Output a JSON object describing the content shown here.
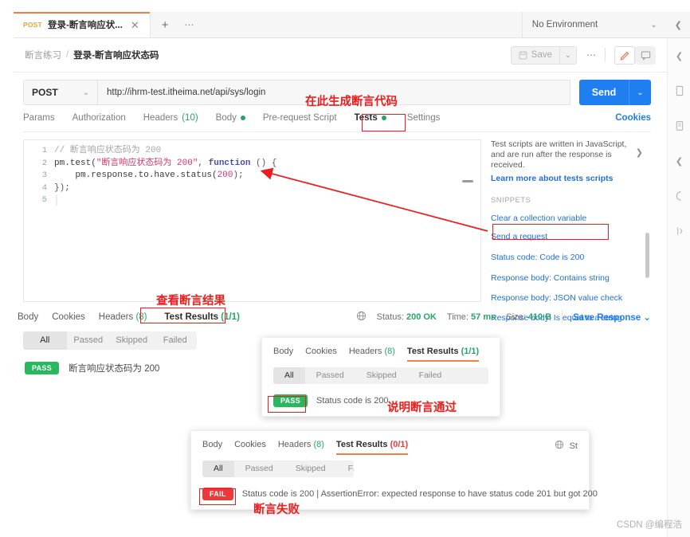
{
  "app": {
    "tab": {
      "method": "POST",
      "title": "登录-断言响应状...",
      "close": "✕",
      "plus": "+",
      "dots": "⋯"
    },
    "environment": {
      "label": "No Environment",
      "chevron": "⌄",
      "eye": "❮"
    },
    "breadcrumb": {
      "collection": "断言练习",
      "separator": "/",
      "request": "登录-断言响应状态码"
    },
    "actions": {
      "save": "Save",
      "save_caret": "⌄",
      "dots": "⋯"
    }
  },
  "request": {
    "method": "POST",
    "method_chevron": "⌄",
    "url": "http://ihrm-test.itheima.net/api/sys/login",
    "send_label": "Send",
    "send_caret": "⌄",
    "tabs": [
      {
        "label": "Params",
        "count": "",
        "dot": false,
        "active": false
      },
      {
        "label": "Authorization",
        "count": "",
        "dot": false,
        "active": false
      },
      {
        "label": "Headers",
        "count": "(10)",
        "dot": false,
        "active": false
      },
      {
        "label": "Body",
        "count": "",
        "dot": true,
        "active": false
      },
      {
        "label": "Pre-request Script",
        "count": "",
        "dot": false,
        "active": false
      },
      {
        "label": "Tests",
        "count": "",
        "dot": true,
        "active": true
      },
      {
        "label": "Settings",
        "count": "",
        "dot": false,
        "active": false
      }
    ],
    "cookies_link": "Cookies"
  },
  "editor": {
    "line_numbers": [
      "1",
      "2",
      "3",
      "4",
      "5"
    ],
    "lines": [
      {
        "n": "1",
        "comment": "// 断言响应状态码为 200"
      },
      {
        "n": "2",
        "text": "pm.test(\"断言响应状态码为 200\", function () {"
      },
      {
        "n": "3",
        "text": "    pm.response.to.have.status(200);"
      },
      {
        "n": "4",
        "text": "});"
      },
      {
        "n": "5",
        "text": ""
      }
    ],
    "l1_comment": "// 断言响应状态码为 200",
    "l2_a": "pm.test(",
    "l2_str": "\"断言响应状态码为 200\"",
    "l2_b": ", ",
    "l2_kw": "function",
    "l2_c": " () {",
    "l3_a": "    pm.response.to.have.status(",
    "l3_num": "200",
    "l3_b": ");",
    "l4": "});"
  },
  "snippets": {
    "help_text": "Test scripts are written in JavaScript, and are run after the response is received.",
    "learn_link": "Learn more about tests scripts",
    "expand_arrow": "❯",
    "section_label": "SNIPPETS",
    "items": [
      "Clear a collection variable",
      "Send a request",
      "Status code: Code is 200",
      "Response body: Contains string",
      "Response body: JSON value check",
      "Response body: Is equal to a string"
    ]
  },
  "response": {
    "tabs": [
      {
        "label": "Body",
        "count": "",
        "active": false
      },
      {
        "label": "Cookies",
        "count": "",
        "active": false
      },
      {
        "label": "Headers",
        "count": "(8)",
        "active": false
      },
      {
        "label": "Test Results",
        "count": "(1/1)",
        "active": true
      }
    ],
    "globe_icon": "⊕",
    "status_label": "Status:",
    "status_value": "200 OK",
    "time_label": "Time:",
    "time_value": "57 ms",
    "size_label": "Size:",
    "size_value": "410 B",
    "save_response": "Save Response",
    "save_response_caret": "⌄",
    "filters": [
      "All",
      "Passed",
      "Skipped",
      "Failed"
    ],
    "active_filter": "All",
    "result": {
      "badge": "PASS",
      "text": "断言响应状态码为 200"
    }
  },
  "overlay_pass": {
    "tabs": [
      {
        "label": "Body",
        "count": "",
        "active": false
      },
      {
        "label": "Cookies",
        "count": "",
        "active": false
      },
      {
        "label": "Headers",
        "count": "(8)",
        "active": false
      },
      {
        "label": "Test Results",
        "count": "(1/1)",
        "active": true
      }
    ],
    "filters": [
      "All",
      "Passed",
      "Skipped",
      "Failed"
    ],
    "active_filter": "All",
    "badge": "PASS",
    "text": "Status code is 200",
    "annotation": "说明断言通过"
  },
  "overlay_fail": {
    "tabs": [
      {
        "label": "Body",
        "count": "",
        "active": false
      },
      {
        "label": "Cookies",
        "count": "",
        "active": false
      },
      {
        "label": "Headers",
        "count": "(8)",
        "active": false
      },
      {
        "label": "Test Results",
        "count": "(0/1)",
        "active": true
      }
    ],
    "globe_icon": "⊕",
    "status_partial": "St",
    "filters": [
      "All",
      "Passed",
      "Skipped",
      "Failed"
    ],
    "active_filter": "All",
    "badge": "FAIL",
    "text": "Status code is 200 | AssertionError: expected response to have status code 201 but got 200",
    "annotation": "断言失败"
  },
  "annotations": {
    "generate_code": "在此生成断言代码",
    "view_results": "查看断言结果"
  },
  "rail_icons": [
    "chevron-left",
    "bracket",
    "layers",
    "comment",
    "info",
    "code"
  ],
  "watermark": "CSDN @编程浩",
  "colors": {
    "accent_orange": "#f08046",
    "send_blue": "#1f7ef0",
    "pass_green": "#29b85f",
    "fail_red": "#e93b3b",
    "annotation_red": "#ee1d1d",
    "link_blue": "#1f6fd6"
  }
}
